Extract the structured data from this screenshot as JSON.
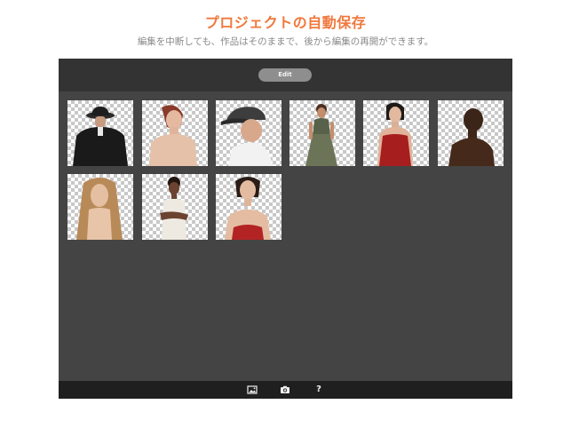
{
  "promo": {
    "title": "プロジェクトの自動保存",
    "subtitle": "編集を中断しても、作品はそのままで、後から編集の再開ができます。"
  },
  "top_bar": {
    "edit_label": "Edit"
  },
  "gallery": {
    "items": [
      {
        "name": "project-man-fedora-back"
      },
      {
        "name": "project-woman-shoulder"
      },
      {
        "name": "project-man-cap"
      },
      {
        "name": "project-woman-dress-standing"
      },
      {
        "name": "project-woman-red-dress"
      },
      {
        "name": "project-man-profile"
      },
      {
        "name": "project-woman-long-hair"
      },
      {
        "name": "project-woman-arms-crossed"
      },
      {
        "name": "project-woman-red-top"
      }
    ]
  },
  "bottom_bar": {
    "icons": [
      "photo-library-icon",
      "camera-icon",
      "help-icon"
    ],
    "help_label": "?"
  },
  "colors": {
    "accent": "#f0783c",
    "frame": "#444444",
    "top_bar": "#333333",
    "bottom_bar": "#1f1f1f"
  }
}
